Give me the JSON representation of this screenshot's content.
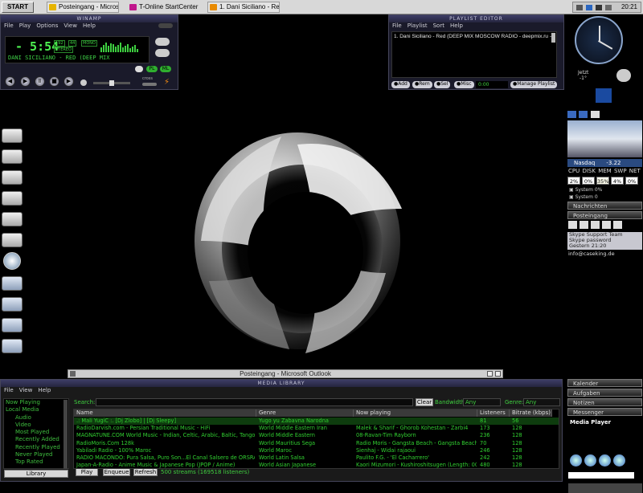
{
  "taskbar": {
    "start": "START",
    "tasks": [
      "Posteingang - Micros...",
      "T-Online StartCenter",
      "1. Dani Siciliano - Re..."
    ],
    "clock": "20:21"
  },
  "winamp": {
    "title": "WINAMP",
    "menu": [
      "File",
      "Play",
      "Options",
      "View",
      "Help"
    ],
    "time": "- 5:54",
    "track_scroll": "DANI SICILIANO - RED (DEEP MIX",
    "kbps": "192",
    "khz": "44",
    "stereo": "STEREO",
    "mono": "MONO",
    "pl": "PL",
    "ml": "ML",
    "crossfade": "cross"
  },
  "playlist": {
    "title": "PLAYLIST EDITOR",
    "menu": [
      "File",
      "Playlist",
      "Sort",
      "Help"
    ],
    "item": "1. Dani Siciliano - Red (DEEP MIX MOSCOW RADIO - deepmix.ru -)",
    "buttons": [
      "Add",
      "Rem",
      "Sel",
      "Misc"
    ],
    "manage": "Manage Playlist",
    "time": "0:00"
  },
  "sidebar": {
    "weather_label": "Jetzt",
    "weather_temp": "-1°",
    "stock": "Nasdaq",
    "stock_value": "-3.22",
    "cpu_headers": [
      "CPU",
      "DISK",
      "MEM",
      "SWP",
      "NET"
    ],
    "cpu_values": [
      "2%",
      "0%",
      "35%",
      "4%",
      "0%"
    ],
    "system1": "System 0%",
    "system2": "System 0",
    "nachrichten": "Nachrichten",
    "posteingang": "Posteingang",
    "mail1": "Skype Support Team",
    "mail2": "Skype password",
    "mail3": "Gestern 21:20",
    "mail4": "info@caseking.de",
    "kalender": "Kalender",
    "aufgaben": "Aufgaben",
    "notizen": "Notizen",
    "messenger": "Messenger",
    "mediaplayer": "Media Player"
  },
  "outlook": {
    "title": "Posteingang - Microsoft Outlook"
  },
  "library": {
    "title": "MEDIA LIBRARY",
    "menu": [
      "File",
      "View",
      "Help"
    ],
    "tree": [
      "Now Playing",
      "Local Media",
      "Audio",
      "Video",
      "Most Played",
      "Recently Added",
      "Recently Played",
      "Never Played",
      "Top Rated"
    ],
    "tree_button": "Library",
    "search_label": "Search:",
    "clear": "Clear",
    "bandwidth_label": "Bandwidth:",
    "bandwidth": "Any",
    "genre_label": "Genre:",
    "genre": "Any",
    "columns": [
      "Name",
      "Genre",
      "Now playing",
      "Listeners",
      "Bitrate (kbps)"
    ],
    "rows": [
      [
        ".: Mali YugiC :. [Dj Zlobo] | [Dj Sleepy]",
        "Yugo yu Zabavna Narodna",
        "",
        "81",
        "56"
      ],
      [
        "RadioDarvish.com - Persian Traditional Music - HiFi",
        "World Middle Eastern Iran",
        "Malek & Sharif - Ghorob Kohestan - Zarbi4",
        "173",
        "128"
      ],
      [
        "MAGNATUNE.COM World Music - Indian, Celtic, Arabic, Baltic, Tango & ...",
        "World Middle Eastern",
        "08-Ravan-Tim Rayborn",
        "236",
        "128"
      ],
      [
        "RadioMoris.Com 128k",
        "World Mauritius Sega",
        "Radio Moris - Gangsta Beach - Gangsta Beach",
        "70",
        "128"
      ],
      [
        "Yabiladi Radio - 100% Maroc",
        "World Maroc",
        "Sienhaj - Widai rajaoui",
        "246",
        "128"
      ],
      [
        "RADIO MACONDO: Pura Salsa, Puro Son...El Canal Salsero de ORSRA...",
        "World Latin Salsa",
        "Paulito F.G. - 'El Cacharrero'",
        "242",
        "128"
      ],
      [
        "Japan-A-Radio - Anime Music & Japanese Pop (JPOP / Anime)",
        "World Asian Japanese",
        "Kaori Mizumori - Kushiroshitsugen (Length: 00:...",
        "480",
        "128"
      ]
    ],
    "play": "Play",
    "enqueue": "Enqueue",
    "refresh": "Refresh",
    "status": "500 streams (169518 listeners)"
  }
}
